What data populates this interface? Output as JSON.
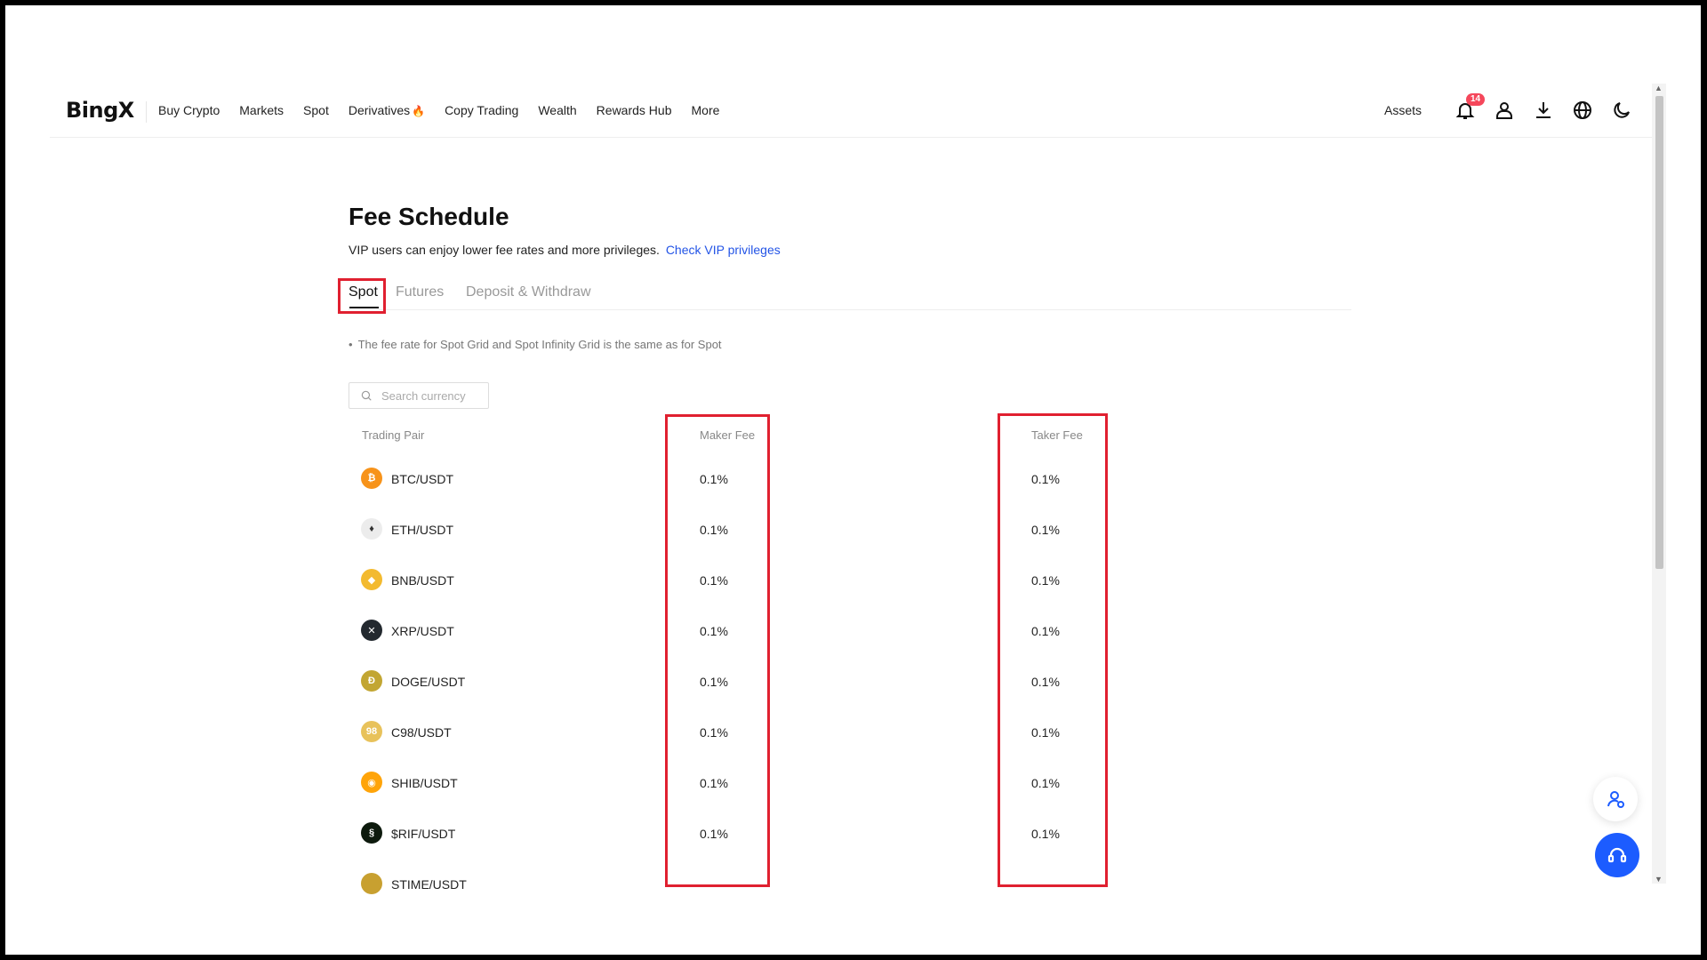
{
  "header": {
    "logo": "BingX",
    "nav": [
      {
        "label": "Buy Crypto"
      },
      {
        "label": "Markets"
      },
      {
        "label": "Spot"
      },
      {
        "label": "Derivatives"
      },
      {
        "label": "Copy Trading"
      },
      {
        "label": "Wealth"
      },
      {
        "label": "Rewards Hub"
      },
      {
        "label": "More"
      }
    ],
    "assets_label": "Assets",
    "notification_count": "14",
    "icons": [
      "bell-icon",
      "user-icon",
      "download-icon",
      "globe-icon",
      "moon-icon"
    ]
  },
  "page": {
    "title": "Fee Schedule",
    "subtitle": "VIP users can enjoy lower fee rates and more privileges.",
    "vip_link": "Check VIP privileges",
    "tabs": [
      {
        "label": "Spot",
        "active": true
      },
      {
        "label": "Futures",
        "active": false
      },
      {
        "label": "Deposit & Withdraw",
        "active": false
      }
    ],
    "note": "The fee rate for Spot Grid and Spot Infinity Grid is the same as for Spot",
    "search_placeholder": "Search currency"
  },
  "table": {
    "columns": [
      "Trading Pair",
      "Maker Fee",
      "Taker Fee"
    ],
    "rows": [
      {
        "pair": "BTC/USDT",
        "maker": "0.1%",
        "taker": "0.1%",
        "icon_color": "#f7931a",
        "glyph": "₿"
      },
      {
        "pair": "ETH/USDT",
        "maker": "0.1%",
        "taker": "0.1%",
        "icon_color": "#ececec",
        "glyph": "♦"
      },
      {
        "pair": "BNB/USDT",
        "maker": "0.1%",
        "taker": "0.1%",
        "icon_color": "#f3ba2f",
        "glyph": "◆"
      },
      {
        "pair": "XRP/USDT",
        "maker": "0.1%",
        "taker": "0.1%",
        "icon_color": "#23292f",
        "glyph": "✕"
      },
      {
        "pair": "DOGE/USDT",
        "maker": "0.1%",
        "taker": "0.1%",
        "icon_color": "#c2a633",
        "glyph": "Ð"
      },
      {
        "pair": "C98/USDT",
        "maker": "0.1%",
        "taker": "0.1%",
        "icon_color": "#e8c25b",
        "glyph": "98"
      },
      {
        "pair": "SHIB/USDT",
        "maker": "0.1%",
        "taker": "0.1%",
        "icon_color": "#ffa409",
        "glyph": "◉"
      },
      {
        "pair": "$RIF/USDT",
        "maker": "0.1%",
        "taker": "0.1%",
        "icon_color": "#0d1a0d",
        "glyph": "§"
      },
      {
        "pair": "STIME/USDT",
        "maker": "",
        "taker": "",
        "icon_color": "#c8a030",
        "glyph": ""
      }
    ]
  },
  "colors": {
    "accent_link": "#2354e6",
    "highlight_box": "#e02030",
    "badge": "#f5475b",
    "support_button": "#1c5cff"
  }
}
